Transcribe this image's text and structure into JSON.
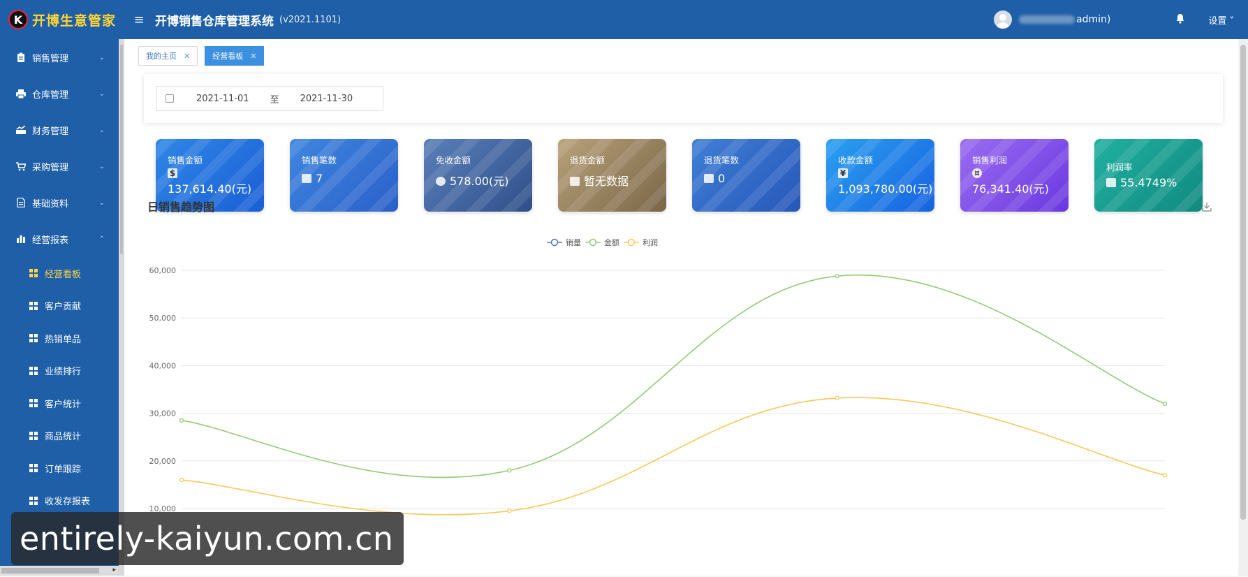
{
  "header": {
    "logo_letter": "K",
    "logo_text": "开博生意管家",
    "menu_icon": "≡",
    "title": "开博销售仓库管理系统",
    "version": "(v2021.1101)",
    "user_suffix": "admin)",
    "settings_label": "设置 ˅"
  },
  "sidebar": {
    "items": [
      {
        "label": "销售管理",
        "icon": "clipboard-icon"
      },
      {
        "label": "仓库管理",
        "icon": "printer-icon"
      },
      {
        "label": "财务管理",
        "icon": "chart-up-icon"
      },
      {
        "label": "采购管理",
        "icon": "cart-icon"
      },
      {
        "label": "基础资料",
        "icon": "document-icon"
      },
      {
        "label": "经营报表",
        "icon": "bar-chart-icon"
      }
    ],
    "subitems": [
      "经营看板",
      "客户贡献",
      "热销单品",
      "业绩排行",
      "客户统计",
      "商品统计",
      "订单跟踪",
      "收发存报表"
    ]
  },
  "tabs": [
    {
      "label": "我的主页"
    },
    {
      "label": "经营看板"
    }
  ],
  "filter": {
    "start_date": "2021-11-01",
    "separator": "至",
    "end_date": "2021-11-30"
  },
  "cards": [
    {
      "label": "销售金额",
      "value": "137,614.40(元)",
      "color_from": "#2f86e6",
      "color_to": "#1a5fd6"
    },
    {
      "label": "销售笔数",
      "value": "7",
      "color_from": "#3f86e0",
      "color_to": "#2a60c8"
    },
    {
      "label": "免收金额",
      "value": "578.00(元)",
      "color_from": "#5a7fb8",
      "color_to": "#2f4f8a"
    },
    {
      "label": "退货金额",
      "value": "暂无数据",
      "color_from": "#b8a27a",
      "color_to": "#7a6648"
    },
    {
      "label": "退货笔数",
      "value": "0",
      "color_from": "#3f7fd6",
      "color_to": "#2757b8"
    },
    {
      "label": "收款金额",
      "value": "1,093,780.00(元)",
      "color_from": "#2aa0f0",
      "color_to": "#1862e0"
    },
    {
      "label": "销售利润",
      "value": "76,341.40(元)",
      "color_from": "#9a6cf0",
      "color_to": "#6a38e0"
    },
    {
      "label": "利润率",
      "value": "55.4749%",
      "color_from": "#1fb0a0",
      "color_to": "#118a80"
    }
  ],
  "chart_title": "日销售趋势图",
  "chart_data": {
    "type": "line",
    "title": "日销售趋势图",
    "ylim": [
      10000,
      60000
    ],
    "yticks": [
      10000,
      20000,
      30000,
      40000,
      50000,
      60000
    ],
    "ytick_labels": [
      "10,000",
      "20,000",
      "30,000",
      "40,000",
      "50,000",
      "60,000"
    ],
    "x": [
      0,
      1,
      2,
      3
    ],
    "legend": [
      "销量",
      "金额",
      "利润"
    ],
    "legend_position": "top-center",
    "grid": true,
    "series": [
      {
        "name": "销量",
        "color": "#5470c6",
        "values": []
      },
      {
        "name": "金额",
        "color": "#91cc75",
        "values": [
          28500,
          18000,
          58800,
          32000
        ]
      },
      {
        "name": "利润",
        "color": "#fac858",
        "values": [
          16000,
          9500,
          33200,
          17000
        ]
      }
    ]
  },
  "watermark": "entirely-kaiyun.com.cn"
}
